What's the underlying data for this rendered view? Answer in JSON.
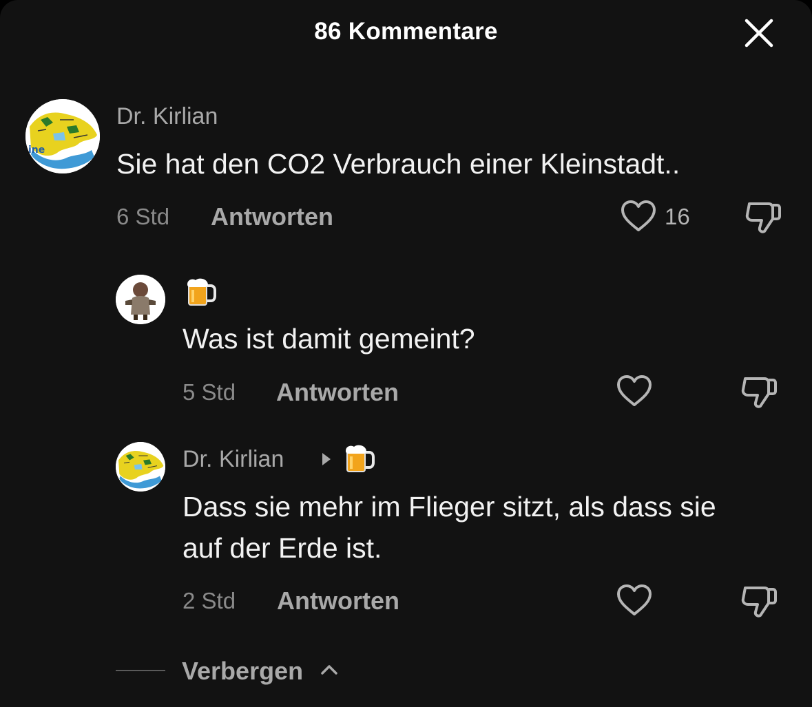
{
  "header": {
    "title": "86 Kommentare"
  },
  "icons": {
    "close": "close-icon",
    "like": "heart-outline-icon",
    "dislike": "thumbs-down-outline-icon",
    "reply_arrow": "caret-right-icon",
    "beer": "beer-mug-emoji",
    "chevron_up": "chevron-up-icon"
  },
  "colors": {
    "background": "#121212",
    "text_primary": "#f2f2f2",
    "text_secondary": "#a9a9a9",
    "text_muted": "#8a8a8a"
  },
  "comments": [
    {
      "username": "Dr. Kirlian",
      "text": "Sie hat den CO2 Verbrauch einer Kleinstadt..",
      "time": "6 Std",
      "reply_label": "Antworten",
      "likes": "16"
    },
    {
      "username": "",
      "username_emoji": "🍺",
      "text": "Was ist damit gemeint?",
      "time": "5 Std",
      "reply_label": "Antworten",
      "likes": ""
    },
    {
      "username": "Dr. Kirlian",
      "reply_to_emoji": "🍺",
      "text_line1": "Dass sie mehr im Flieger sitzt, als dass sie",
      "text_line2": "auf der Erde ist.",
      "time": "2 Std",
      "reply_label": "Antworten",
      "likes": ""
    }
  ],
  "footer": {
    "hide_label": "Verbergen"
  }
}
